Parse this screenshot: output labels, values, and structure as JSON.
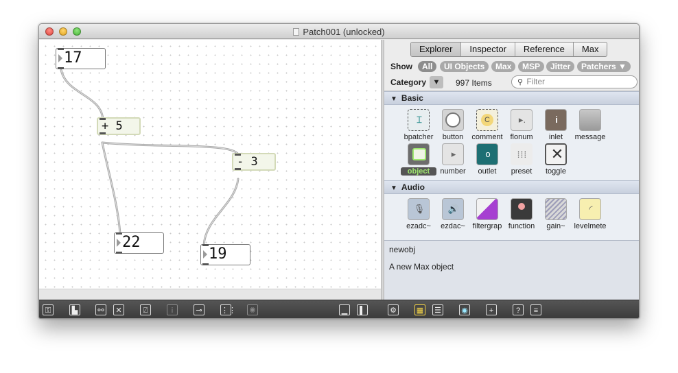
{
  "window": {
    "title": "Patch001 (unlocked)"
  },
  "patcher": {
    "boxes": [
      {
        "kind": "number",
        "value": "17"
      },
      {
        "kind": "object",
        "value": "+ 5"
      },
      {
        "kind": "object",
        "value": "- 3"
      },
      {
        "kind": "number",
        "value": "22"
      },
      {
        "kind": "number",
        "value": "19"
      }
    ]
  },
  "toolbar": {
    "icons": [
      "lock-icon",
      "presentation-icon",
      "binoculars-icon",
      "clear-icon",
      "easel-icon",
      "info-icon",
      "connect-icon",
      "grid-icon",
      "debug-icon",
      "layout-bottom-icon",
      "layout-split-icon"
    ]
  },
  "sidebar": {
    "tabs": [
      "Explorer",
      "Inspector",
      "Reference",
      "Max"
    ],
    "show_label": "Show",
    "filters": [
      "All",
      "UI Objects",
      "Max",
      "MSP",
      "Jitter",
      "Patchers ▼"
    ],
    "category_label": "Category",
    "category_arrow": "▼",
    "item_count": "997 Items",
    "filter_placeholder": "Filter",
    "sections": [
      {
        "name": "Basic",
        "items": [
          "bpatcher",
          "button",
          "comment",
          "flonum",
          "inlet",
          "message",
          "object",
          "number",
          "outlet",
          "preset",
          "toggle"
        ]
      },
      {
        "name": "Audio",
        "items": [
          "ezadc~",
          "ezdac~",
          "filtergrap",
          "function",
          "gain~",
          "levelmete"
        ]
      }
    ],
    "description": {
      "name": "newobj",
      "text": "A new Max object"
    },
    "bottom_icons": [
      "gear-icon",
      "grid-view-icon",
      "list-view-icon",
      "eye-icon",
      "plus-icon",
      "help-icon",
      "menu-icon"
    ]
  }
}
